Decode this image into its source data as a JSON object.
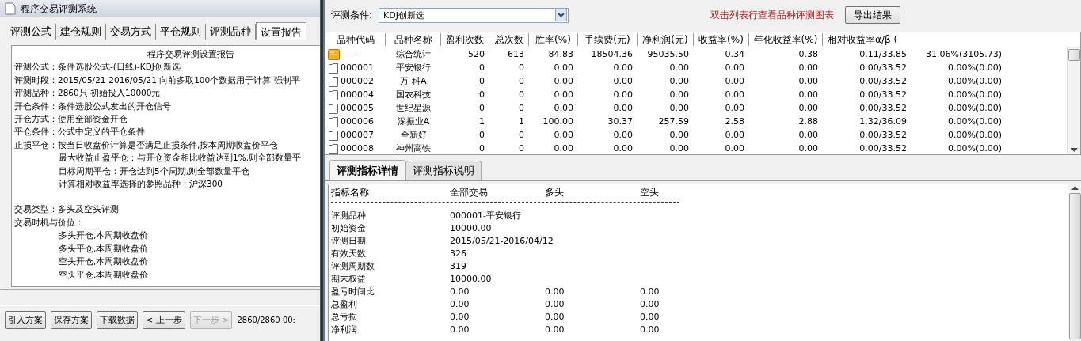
{
  "left_window": {
    "title": "程序交易评测系统",
    "tabs": [
      {
        "label": "评测公式",
        "selected": false
      },
      {
        "label": "建仓规则",
        "selected": false
      },
      {
        "label": "交易方式",
        "selected": false
      },
      {
        "label": "平仓规则",
        "selected": false
      },
      {
        "label": "评测品种",
        "selected": false
      },
      {
        "label": "设置报告",
        "selected": true
      }
    ],
    "report": {
      "title": "程序交易评测设置报告",
      "sections": [
        [
          {
            "label": "评测公式：",
            "text": "条件选股公式-(日线)-KDJ创新选"
          },
          {
            "label": "评测时段：",
            "text": "2015/05/21-2016/05/21 向前多取100个数据用于计算 强制平"
          },
          {
            "label": "评测品种：",
            "text": "2860只 初始投入10000元"
          },
          {
            "label": "开仓条件：",
            "text": "条件选股公式发出的开仓信号"
          },
          {
            "label": "开仓方式：",
            "text": "使用全部资金开仓"
          },
          {
            "label": "平仓条件：",
            "text": "公式中定义的平仓条件"
          },
          {
            "label": "止损平仓：",
            "text": "按当日收盘价计算是否满足止损条件,按本周期收盘价平仓"
          },
          {
            "text": "最大收益止盈平仓：与开仓资金相比收益达到1%,则全部数量平"
          },
          {
            "text": "目标周期平仓：开仓达到5个周期,则全部数量平仓"
          },
          {
            "text": "计算相对收益率选择的参照品种：沪深300"
          }
        ],
        [
          {
            "label": "交易类型：",
            "text": "多头及空头评测"
          },
          {
            "label": "交易时机与价位："
          },
          {
            "text": "多头开仓,本周期收盘价"
          },
          {
            "text": "多头平仓,本周期收盘价"
          },
          {
            "text": "空头开仓,本周期收盘价"
          },
          {
            "text": "空头平仓,本周期收盘价"
          }
        ]
      ]
    },
    "buttons": [
      {
        "label": "引入方案",
        "disabled": false
      },
      {
        "label": "保存方案",
        "disabled": false
      },
      {
        "label": "下载数据",
        "disabled": false
      },
      {
        "label": "< 上一步",
        "disabled": false
      },
      {
        "label": "下一步 >",
        "disabled": true
      }
    ],
    "status": "2860/2860 00:"
  },
  "right_window": {
    "condition_label": "评测条件:",
    "condition_value": "KDJ创新选",
    "hint": "双击列表行查看品种评测图表",
    "export_button": "导出结果",
    "table": {
      "columns": [
        "品种代码",
        "品种名称",
        "盈利次数",
        "总次数",
        "胜率(%)",
        "手续费(元)",
        "净利润(元)",
        "收益率(%)",
        "年化收益率(%)",
        "相对收益率α/β ("
      ],
      "rows": [
        {
          "kind": "summary",
          "cells": [
            "------",
            "综合统计",
            "520",
            "613",
            "84.83",
            "18504.36",
            "95035.50",
            "0.34",
            "0.38",
            "0.11/33.85",
            "31.06%(3105.73)"
          ]
        },
        {
          "kind": "stock",
          "cells": [
            "000001",
            "平安银行",
            "0",
            "0",
            "0.00",
            "0.00",
            "0.00",
            "0.00",
            "0.00",
            "0.00/33.52",
            "0.00%(0.00)"
          ]
        },
        {
          "kind": "stock",
          "cells": [
            "000002",
            "万 科A",
            "0",
            "0",
            "0.00",
            "0.00",
            "0.00",
            "0.00",
            "0.00",
            "0.00/33.52",
            "0.00%(0.00)"
          ]
        },
        {
          "kind": "stock",
          "cells": [
            "000004",
            "国农科技",
            "0",
            "0",
            "0.00",
            "0.00",
            "0.00",
            "0.00",
            "0.00",
            "0.00/33.52",
            "0.00%(0.00)"
          ]
        },
        {
          "kind": "stock",
          "cells": [
            "000005",
            "世纪星源",
            "0",
            "0",
            "0.00",
            "0.00",
            "0.00",
            "0.00",
            "0.00",
            "0.00/33.52",
            "0.00%(0.00)"
          ]
        },
        {
          "kind": "stock",
          "cells": [
            "000006",
            "深振业A",
            "1",
            "1",
            "100.00",
            "30.37",
            "257.59",
            "2.58",
            "2.88",
            "1.32/36.09",
            "0.00%(0.00)"
          ]
        },
        {
          "kind": "stock",
          "cells": [
            "000007",
            "全新好",
            "0",
            "0",
            "0.00",
            "0.00",
            "0.00",
            "0.00",
            "0.00",
            "0.00/33.52",
            "0.00%(0.00)"
          ]
        },
        {
          "kind": "stock",
          "cells": [
            "000008",
            "神州高铁",
            "0",
            "0",
            "0.00",
            "0.00",
            "0.00",
            "0.00",
            "0.00",
            "0.00/33.52",
            "0.00%(0.00)"
          ]
        }
      ]
    },
    "detail_tabs": [
      {
        "label": "评测指标详情",
        "selected": true
      },
      {
        "label": "评测指标说明",
        "selected": false
      }
    ],
    "details": {
      "columns": [
        "指标名称",
        "全部交易",
        "多头",
        "空头"
      ],
      "rows": [
        [
          "评测品种",
          "000001-平安银行"
        ],
        [
          "初始资金",
          "10000.00"
        ],
        [
          "评测日期",
          "2015/05/21-2016/04/12"
        ],
        [
          "有效天数",
          "326"
        ],
        [
          "评测周期数",
          "319"
        ],
        [
          "期末权益",
          "10000.00"
        ],
        [
          "盈亏时间比",
          "0.00",
          "0.00",
          "0.00"
        ],
        [
          "总盈利",
          "0.00",
          "0.00",
          "0.00"
        ],
        [
          "总亏损",
          "0.00",
          "0.00",
          "0.00"
        ],
        [
          "净利润",
          "0.00",
          "0.00",
          "0.00"
        ]
      ]
    }
  }
}
